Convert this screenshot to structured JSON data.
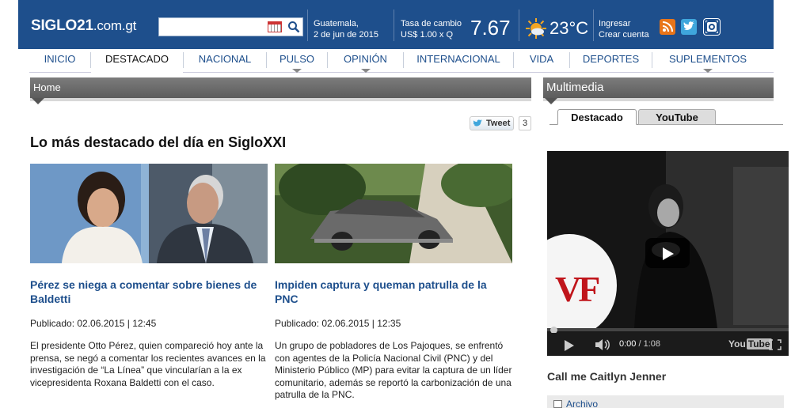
{
  "header": {
    "logo_main": "SIGLO21",
    "logo_domain": ".com.gt",
    "search_placeholder": "",
    "city": "Guatemala,",
    "date": "2 de jun de 2015",
    "fx_label": "Tasa de cambio",
    "fx_unit": "US$ 1.00 x Q",
    "fx_value": "7.67",
    "temperature": "23°C",
    "login": "Ingresar",
    "register": "Crear cuenta"
  },
  "nav": {
    "items": [
      {
        "label": "INICIO"
      },
      {
        "label": "DESTACADO"
      },
      {
        "label": "NACIONAL"
      },
      {
        "label": "PULSO"
      },
      {
        "label": "OPINIÓN"
      },
      {
        "label": "INTERNACIONAL"
      },
      {
        "label": "VIDA"
      },
      {
        "label": "DEPORTES"
      },
      {
        "label": "SUPLEMENTOS"
      }
    ]
  },
  "main": {
    "breadcrumb": "Home",
    "tweet_label": "Tweet",
    "tweet_count": "3",
    "section_title": "Lo más destacado del día en SigloXXI",
    "articles": [
      {
        "title": "Pérez se niega a comentar sobre bienes de Baldetti",
        "meta": "Publicado: 02.06.2015 | 12:45",
        "body": "El presidente Otto Pérez, quien compareció hoy ante la prensa, se negó a comentar los recientes avances en la investigación de “La Línea” que vincularían a la ex vicepresidenta Roxana Baldetti con el caso."
      },
      {
        "title": "Impiden captura y queman patrulla de la PNC",
        "meta": "Publicado: 02.06.2015 | 12:35",
        "body": "Un grupo de pobladores de Los Pajoques, se enfrentó con agentes de la Policía Nacional Civil (PNC) y del Ministerio Público (MP) para evitar la captura de un líder comunitario, además se reportó la carbonización de una patrulla de la PNC."
      }
    ]
  },
  "sidebar": {
    "title": "Multimedia",
    "tabs": [
      {
        "label": "Destacado"
      },
      {
        "label": "YouTube"
      }
    ],
    "video": {
      "overlay_logo": "VF",
      "current_time": "0:00",
      "duration": "/ 1:08",
      "brand_a": "You",
      "brand_b": "Tube"
    },
    "video_caption": "Call me Caitlyn Jenner",
    "archive_label": "Archivo"
  }
}
